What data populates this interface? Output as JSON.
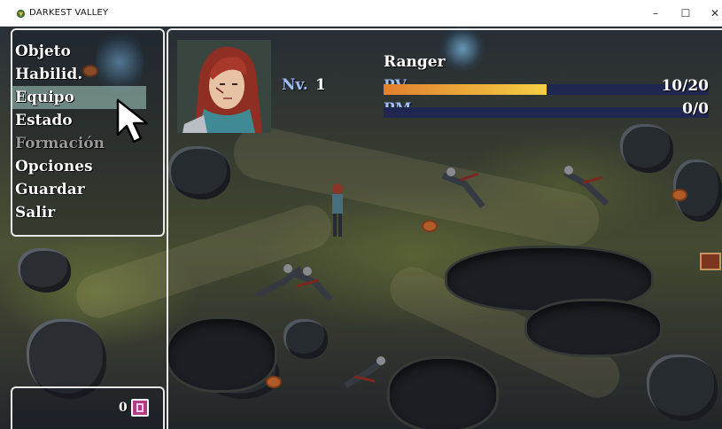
{
  "window": {
    "title": "DARKEST VALLEY",
    "controls": {
      "minimize": "–",
      "maximize": "☐",
      "close": "✕"
    }
  },
  "menu": {
    "items": [
      {
        "label": "Objeto",
        "state": "enabled"
      },
      {
        "label": "Habilid.",
        "state": "enabled"
      },
      {
        "label": "Equipo",
        "state": "selected"
      },
      {
        "label": "Estado",
        "state": "enabled"
      },
      {
        "label": "Formación",
        "state": "disabled"
      },
      {
        "label": "Opciones",
        "state": "enabled"
      },
      {
        "label": "Guardar",
        "state": "enabled"
      },
      {
        "label": "Salir",
        "state": "enabled"
      }
    ]
  },
  "actor": {
    "name": "Ranger",
    "level_label": "Nv.",
    "level": "1",
    "hp_label": "PV",
    "hp_value": "10/20",
    "hp_fraction": 0.5,
    "mp_label": "PM",
    "mp_value": "0/0",
    "mp_fraction": 0
  },
  "gold": {
    "value": "0",
    "icon": "gold-bag-icon"
  },
  "colors": {
    "system_blue": "#9fbff8",
    "hp_gauge_start": "#e0802e",
    "hp_gauge_end": "#f4cf44",
    "gauge_back": "#1f2750",
    "selection": "#aad2c8",
    "disabled_text": "#9a9a9a"
  }
}
